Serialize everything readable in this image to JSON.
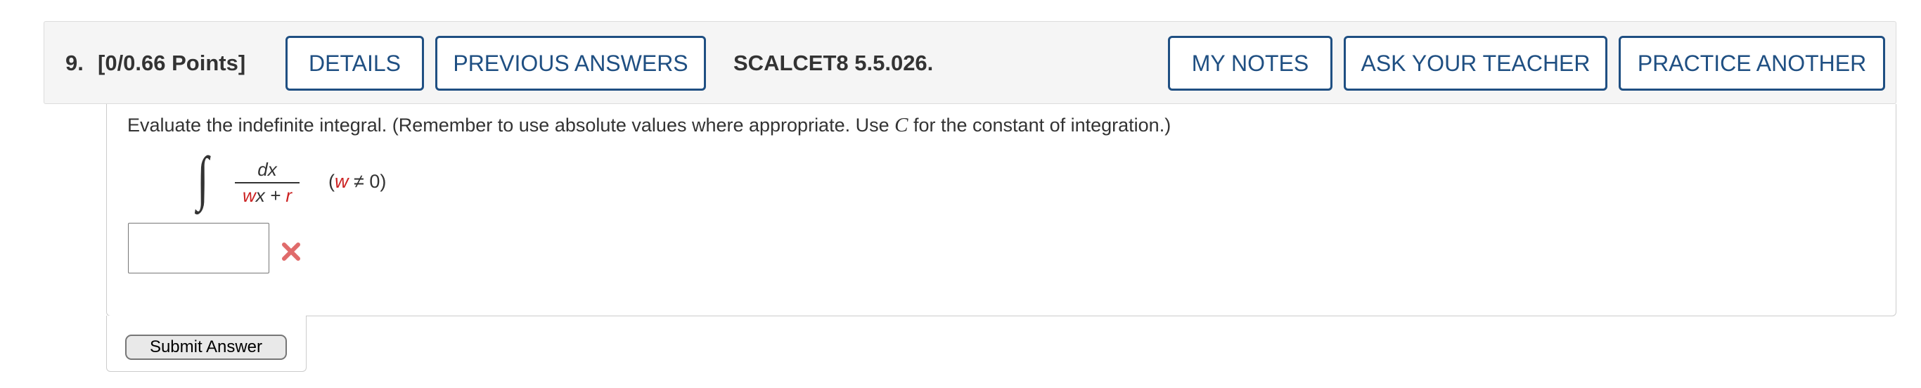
{
  "question": {
    "number": "9.",
    "points": "[0/0.66 Points]",
    "reference": "SCALCET8 5.5.026."
  },
  "header_buttons": {
    "details": "DETAILS",
    "previous_answers": "PREVIOUS ANSWERS",
    "my_notes": "MY NOTES",
    "ask_teacher": "ASK YOUR TEACHER",
    "practice_another": "PRACTICE ANOTHER"
  },
  "body": {
    "instruction_start": "Evaluate the indefinite integral. (Remember to use absolute values where appropriate. Use ",
    "instruction_var": "C",
    "instruction_end": " for the constant of integration.)",
    "integral_sign": "∫",
    "numerator": "dx",
    "den_w": "w",
    "den_x": "x + ",
    "den_r": "r",
    "cond_open": "(",
    "cond_w": "w",
    "cond_rest": " ≠ 0)"
  },
  "answer": {
    "value": "",
    "status": "incorrect",
    "status_icon": "x-icon",
    "status_color": "#e06b6b"
  },
  "submit": {
    "label": "Submit Answer"
  },
  "colors": {
    "accent": "#1f4f82",
    "variable_red": "#cc2222"
  }
}
